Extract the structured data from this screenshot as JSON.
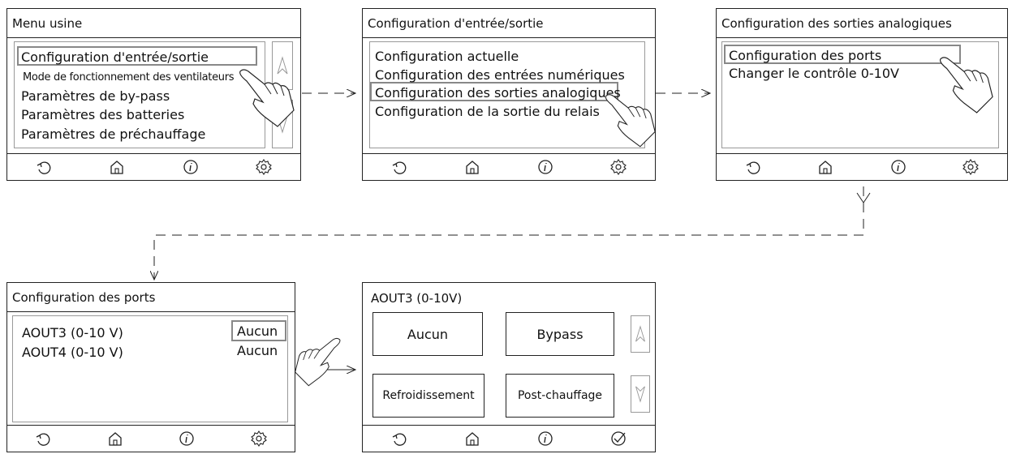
{
  "screens": {
    "menu_usine": {
      "title": "Menu usine",
      "items": [
        "Configuration d'entrée/sortie",
        "Mode de fonctionnement des ventilateurs",
        "Paramètres de by-pass",
        "Paramètres des batteries",
        "Paramètres de préchauffage"
      ]
    },
    "io_config": {
      "title": "Configuration d'entrée/sortie",
      "items": [
        "Configuration actuelle",
        "Configuration des entrées numériques",
        "Configuration des sorties analogiques",
        "Configuration de la sortie du relais"
      ]
    },
    "analog_outputs": {
      "title": "Configuration des sorties analogiques",
      "items": [
        "Configuration des ports",
        "Changer le contrôle 0-10V"
      ]
    },
    "ports": {
      "title": "Configuration des ports",
      "rows": [
        {
          "label": "AOUT3 (0-10 V)",
          "value": "Aucun"
        },
        {
          "label": "AOUT4 (0-10 V)",
          "value": "Aucun"
        }
      ]
    },
    "aout3": {
      "title": "AOUT3 (0-10V)",
      "options": [
        "Aucun",
        "Bypass",
        "Refroidissement",
        "Post-chauffage"
      ]
    }
  },
  "icons": {
    "footer_standard": [
      "back-icon",
      "home-icon",
      "info-icon",
      "settings-icon"
    ],
    "footer_confirm": [
      "back-icon",
      "home-icon",
      "info-icon",
      "check-icon"
    ],
    "scroll": [
      "arrow-up-icon",
      "arrow-down-icon"
    ],
    "pointer": "hand-pointer-icon"
  },
  "colors": {
    "outline": "#222222",
    "selection": "#888888"
  }
}
